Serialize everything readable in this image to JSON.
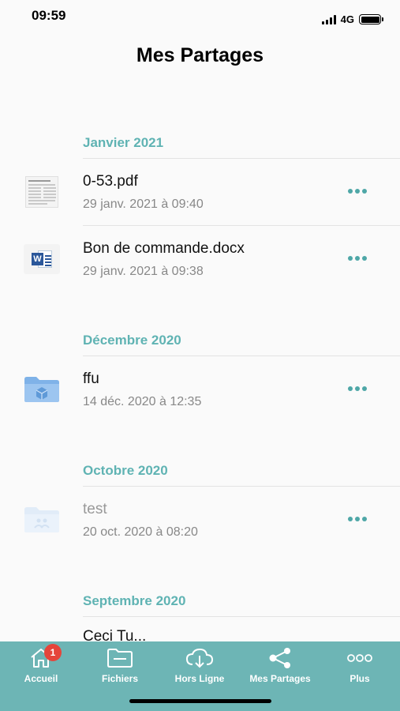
{
  "status_bar": {
    "time": "09:59",
    "network": "4G"
  },
  "header": {
    "title": "Mes Partages"
  },
  "sections": [
    {
      "label": "Janvier 2021",
      "items": [
        {
          "name": "0-53.pdf",
          "date": "29 janv. 2021 à 09:40",
          "icon": "pdf-thumbnail"
        },
        {
          "name": "Bon de commande.docx",
          "date": "29 janv. 2021 à 09:38",
          "icon": "word-document-icon"
        }
      ]
    },
    {
      "label": "Décembre 2020",
      "items": [
        {
          "name": "ffu",
          "date": "14 déc. 2020 à 12:35",
          "icon": "shared-folder-icon"
        }
      ]
    },
    {
      "label": "Octobre 2020",
      "items": [
        {
          "name": "test",
          "date": "20 oct. 2020 à 08:20",
          "icon": "shared-folder-icon"
        }
      ]
    },
    {
      "label": "Septembre 2020",
      "items": [
        {
          "name": "Ceci Tu...",
          "date": "",
          "icon": ""
        }
      ]
    }
  ],
  "tabbar": {
    "tabs": [
      {
        "label": "Accueil",
        "icon": "home-icon",
        "badge": "1"
      },
      {
        "label": "Fichiers",
        "icon": "folder-icon"
      },
      {
        "label": "Hors Ligne",
        "icon": "cloud-download-icon"
      },
      {
        "label": "Mes Partages",
        "icon": "share-icon"
      },
      {
        "label": "Plus",
        "icon": "more-icon"
      }
    ]
  },
  "colors": {
    "accent": "#5fb3b3",
    "tabbar": "#6db5b5",
    "badge": "#e5453b",
    "folder": "#7fb2e8"
  }
}
